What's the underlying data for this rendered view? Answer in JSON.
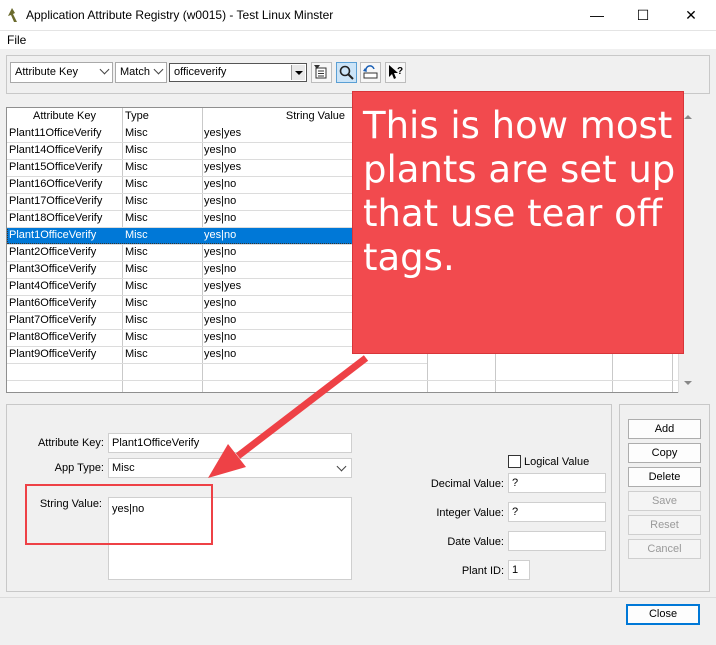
{
  "window": {
    "title": "Application Attribute Registry (w0015) - Test Linux Minster",
    "minimize": "—",
    "maximize": "☐",
    "close": "✕"
  },
  "menu": {
    "file": "File"
  },
  "toolbar": {
    "field_select": "Attribute Key",
    "match_select": "Match",
    "search_value": "officeverify"
  },
  "grid": {
    "headers": [
      "Attribute Key",
      "Type",
      "String Value"
    ],
    "rows": [
      [
        "Plant11OfficeVerify",
        "Misc",
        "yes|yes"
      ],
      [
        "Plant14OfficeVerify",
        "Misc",
        "yes|no"
      ],
      [
        "Plant15OfficeVerify",
        "Misc",
        "yes|yes"
      ],
      [
        "Plant16OfficeVerify",
        "Misc",
        "yes|no"
      ],
      [
        "Plant17OfficeVerify",
        "Misc",
        "yes|no"
      ],
      [
        "Plant18OfficeVerify",
        "Misc",
        "yes|no"
      ],
      [
        "Plant1OfficeVerify",
        "Misc",
        "yes|no"
      ],
      [
        "Plant2OfficeVerify",
        "Misc",
        "yes|no"
      ],
      [
        "Plant3OfficeVerify",
        "Misc",
        "yes|no"
      ],
      [
        "Plant4OfficeVerify",
        "Misc",
        "yes|yes"
      ],
      [
        "Plant6OfficeVerify",
        "Misc",
        "yes|no"
      ],
      [
        "Plant7OfficeVerify",
        "Misc",
        "yes|no"
      ],
      [
        "Plant8OfficeVerify",
        "Misc",
        "yes|no"
      ],
      [
        "Plant9OfficeVerify",
        "Misc",
        "yes|no"
      ]
    ],
    "selected_index": 6
  },
  "detail": {
    "attribute_key_label": "Attribute Key:",
    "attribute_key_value": "Plant1OfficeVerify",
    "app_type_label": "App Type:",
    "app_type_value": "Misc",
    "string_value_label": "String Value:",
    "string_value": "yes|no",
    "logical_value_label": "Logical Value",
    "decimal_value_label": "Decimal Value:",
    "decimal_value": "?",
    "integer_value_label": "Integer Value:",
    "integer_value": "?",
    "date_value_label": "Date Value:",
    "date_value": "",
    "plant_id_label": "Plant ID:",
    "plant_id": "1"
  },
  "buttons": {
    "add": "Add",
    "copy": "Copy",
    "delete": "Delete",
    "save": "Save",
    "reset": "Reset",
    "cancel": "Cancel",
    "close": "Close"
  },
  "annotation": {
    "text": "This is how most plants are set up that use tear off tags.",
    "color": "#f24a4e"
  }
}
